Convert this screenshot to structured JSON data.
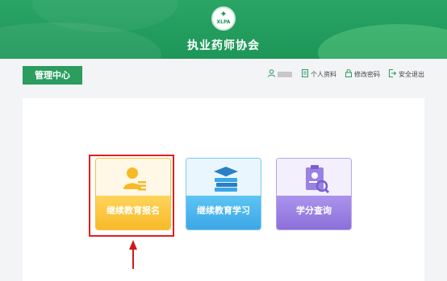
{
  "header": {
    "logo_text": "XLPA",
    "site_title": "执业药师协会"
  },
  "toolbar": {
    "management_center": "管理中心",
    "profile": "个人资料",
    "change_password": "修改密码",
    "logout": "安全退出"
  },
  "cards": [
    {
      "label": "继续教育报名",
      "icon": "user-card-icon",
      "color": "#f7b928"
    },
    {
      "label": "继续教育学习",
      "icon": "books-graduation-cap-icon",
      "color": "#3aa6e6"
    },
    {
      "label": "学分查询",
      "icon": "clipboard-search-icon",
      "color": "#8a6ed8"
    }
  ],
  "colors": {
    "brand_green": "#1d9658",
    "highlight_red": "#e02020"
  }
}
